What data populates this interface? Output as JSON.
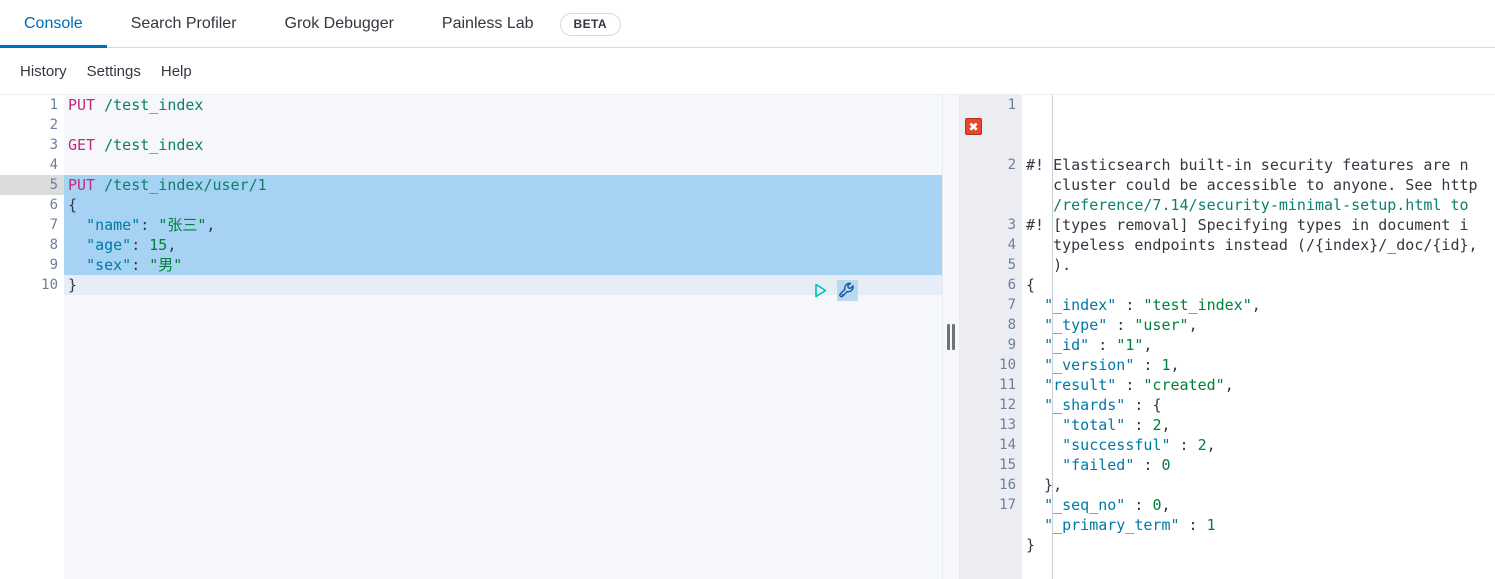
{
  "tabs": [
    {
      "label": "Console",
      "active": true
    },
    {
      "label": "Search Profiler",
      "active": false
    },
    {
      "label": "Grok Debugger",
      "active": false
    },
    {
      "label": "Painless Lab",
      "active": false
    }
  ],
  "beta_badge": "BETA",
  "menu": [
    {
      "label": "History"
    },
    {
      "label": "Settings"
    },
    {
      "label": "Help"
    }
  ],
  "colors": {
    "accent": "#0071c2",
    "active_tab_text": "#006bb4",
    "method": "#c4297b",
    "url": "#0a7f6c",
    "json_key": "#0079a5",
    "json_string": "#00803a",
    "selection": "#a6d2f4",
    "error_marker": "#e8462f",
    "editor_bg": "#f5f7fa",
    "gutter_right_bg": "#ebedf2"
  },
  "request_editor": {
    "name": "console-request-editor",
    "active_line": 5,
    "selected_lines": [
      5,
      6,
      7,
      8,
      9
    ],
    "fold_markers": {
      "6": "down",
      "10": "up"
    },
    "lines": [
      {
        "n": 1,
        "tokens": [
          {
            "t": "PUT",
            "c": "method"
          },
          {
            "t": " ",
            "c": "punct"
          },
          {
            "t": "/test_index",
            "c": "url"
          }
        ]
      },
      {
        "n": 2,
        "tokens": []
      },
      {
        "n": 3,
        "tokens": [
          {
            "t": "GET",
            "c": "method"
          },
          {
            "t": " ",
            "c": "punct"
          },
          {
            "t": "/test_index",
            "c": "url"
          }
        ]
      },
      {
        "n": 4,
        "tokens": []
      },
      {
        "n": 5,
        "tokens": [
          {
            "t": "PUT",
            "c": "method"
          },
          {
            "t": " ",
            "c": "punct"
          },
          {
            "t": "/test_index/user/1",
            "c": "url"
          }
        ]
      },
      {
        "n": 6,
        "tokens": [
          {
            "t": "{",
            "c": "punct"
          }
        ]
      },
      {
        "n": 7,
        "tokens": [
          {
            "t": "  ",
            "c": "punct"
          },
          {
            "t": "\"name\"",
            "c": "key"
          },
          {
            "t": ": ",
            "c": "punct"
          },
          {
            "t": "\"张三\"",
            "c": "str"
          },
          {
            "t": ",",
            "c": "punct"
          }
        ]
      },
      {
        "n": 8,
        "tokens": [
          {
            "t": "  ",
            "c": "punct"
          },
          {
            "t": "\"age\"",
            "c": "key"
          },
          {
            "t": ": ",
            "c": "punct"
          },
          {
            "t": "15",
            "c": "num"
          },
          {
            "t": ",",
            "c": "punct"
          }
        ]
      },
      {
        "n": 9,
        "tokens": [
          {
            "t": "  ",
            "c": "punct"
          },
          {
            "t": "\"sex\"",
            "c": "key"
          },
          {
            "t": ": ",
            "c": "punct"
          },
          {
            "t": "\"男\"",
            "c": "str"
          }
        ]
      },
      {
        "n": 10,
        "tokens": [
          {
            "t": "}",
            "c": "punct"
          }
        ]
      }
    ],
    "actions": {
      "play_label": "send-request",
      "wrench_label": "request-options"
    }
  },
  "response_editor": {
    "name": "console-response-editor",
    "error_marker": "✖",
    "fold_markers": {
      "3": "down",
      "9": "down",
      "13": "up",
      "16": "up"
    },
    "lines": [
      {
        "n": 1,
        "tokens": [
          {
            "t": "#! Elasticsearch built-in security features are n",
            "c": "warn"
          }
        ]
      },
      {
        "n": "",
        "tokens": [
          {
            "t": "   cluster could be accessible to anyone. See http",
            "c": "warn"
          }
        ]
      },
      {
        "n": "",
        "tokens": [
          {
            "t": "   /reference/7.14/security-minimal-setup.html to",
            "c": "warnlink"
          }
        ]
      },
      {
        "n": 2,
        "tokens": [
          {
            "t": "#! [types removal] Specifying types in document i",
            "c": "warn"
          }
        ]
      },
      {
        "n": "",
        "tokens": [
          {
            "t": "   typeless endpoints instead (/{index}/_doc/{id},",
            "c": "warn"
          }
        ]
      },
      {
        "n": "",
        "tokens": [
          {
            "t": "   ).",
            "c": "warn"
          }
        ]
      },
      {
        "n": 3,
        "tokens": [
          {
            "t": "{",
            "c": "punct"
          }
        ]
      },
      {
        "n": 4,
        "tokens": [
          {
            "t": "  ",
            "c": "punct"
          },
          {
            "t": "\"_index\"",
            "c": "key"
          },
          {
            "t": " : ",
            "c": "punct"
          },
          {
            "t": "\"test_index\"",
            "c": "str"
          },
          {
            "t": ",",
            "c": "punct"
          }
        ]
      },
      {
        "n": 5,
        "tokens": [
          {
            "t": "  ",
            "c": "punct"
          },
          {
            "t": "\"_type\"",
            "c": "key"
          },
          {
            "t": " : ",
            "c": "punct"
          },
          {
            "t": "\"user\"",
            "c": "str"
          },
          {
            "t": ",",
            "c": "punct"
          }
        ]
      },
      {
        "n": 6,
        "tokens": [
          {
            "t": "  ",
            "c": "punct"
          },
          {
            "t": "\"_id\"",
            "c": "key"
          },
          {
            "t": " : ",
            "c": "punct"
          },
          {
            "t": "\"1\"",
            "c": "str"
          },
          {
            "t": ",",
            "c": "punct"
          }
        ]
      },
      {
        "n": 7,
        "tokens": [
          {
            "t": "  ",
            "c": "punct"
          },
          {
            "t": "\"_version\"",
            "c": "key"
          },
          {
            "t": " : ",
            "c": "punct"
          },
          {
            "t": "1",
            "c": "num"
          },
          {
            "t": ",",
            "c": "punct"
          }
        ]
      },
      {
        "n": 8,
        "tokens": [
          {
            "t": "  ",
            "c": "punct"
          },
          {
            "t": "\"result\"",
            "c": "key"
          },
          {
            "t": " : ",
            "c": "punct"
          },
          {
            "t": "\"created\"",
            "c": "str"
          },
          {
            "t": ",",
            "c": "punct"
          }
        ]
      },
      {
        "n": 9,
        "tokens": [
          {
            "t": "  ",
            "c": "punct"
          },
          {
            "t": "\"_shards\"",
            "c": "key"
          },
          {
            "t": " : ",
            "c": "punct"
          },
          {
            "t": "{",
            "c": "punct"
          }
        ]
      },
      {
        "n": 10,
        "tokens": [
          {
            "t": "    ",
            "c": "punct"
          },
          {
            "t": "\"total\"",
            "c": "key"
          },
          {
            "t": " : ",
            "c": "punct"
          },
          {
            "t": "2",
            "c": "num"
          },
          {
            "t": ",",
            "c": "punct"
          }
        ]
      },
      {
        "n": 11,
        "tokens": [
          {
            "t": "    ",
            "c": "punct"
          },
          {
            "t": "\"successful\"",
            "c": "key"
          },
          {
            "t": " : ",
            "c": "punct"
          },
          {
            "t": "2",
            "c": "num"
          },
          {
            "t": ",",
            "c": "punct"
          }
        ]
      },
      {
        "n": 12,
        "tokens": [
          {
            "t": "    ",
            "c": "punct"
          },
          {
            "t": "\"failed\"",
            "c": "key"
          },
          {
            "t": " : ",
            "c": "punct"
          },
          {
            "t": "0",
            "c": "num"
          }
        ]
      },
      {
        "n": 13,
        "tokens": [
          {
            "t": "  },",
            "c": "punct"
          }
        ]
      },
      {
        "n": 14,
        "tokens": [
          {
            "t": "  ",
            "c": "punct"
          },
          {
            "t": "\"_seq_no\"",
            "c": "key"
          },
          {
            "t": " : ",
            "c": "punct"
          },
          {
            "t": "0",
            "c": "num"
          },
          {
            "t": ",",
            "c": "punct"
          }
        ]
      },
      {
        "n": 15,
        "tokens": [
          {
            "t": "  ",
            "c": "punct"
          },
          {
            "t": "\"_primary_term\"",
            "c": "key"
          },
          {
            "t": " : ",
            "c": "punct"
          },
          {
            "t": "1",
            "c": "num"
          }
        ]
      },
      {
        "n": 16,
        "tokens": [
          {
            "t": "}",
            "c": "punct"
          }
        ]
      },
      {
        "n": 17,
        "tokens": []
      }
    ]
  },
  "splitter": {
    "label": "pane-resize-handle"
  }
}
